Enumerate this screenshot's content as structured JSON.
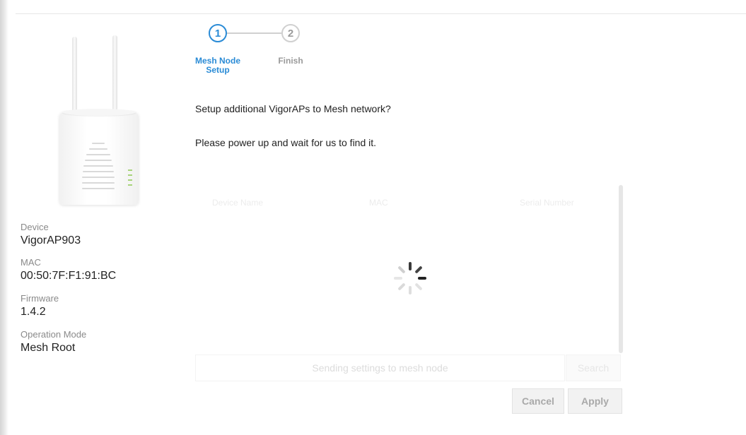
{
  "stepper": {
    "steps": [
      {
        "number": "1",
        "label": "Mesh Node\nSetup",
        "state": "active"
      },
      {
        "number": "2",
        "label": "Finish",
        "state": "inactive"
      }
    ],
    "active_color": "#2a8bd6"
  },
  "device_info": {
    "device_label": "Device",
    "device_value": "VigorAP903",
    "mac_label": "MAC",
    "mac_value": "00:50:7F:F1:91:BC",
    "firmware_label": "Firmware",
    "firmware_value": "1.4.2",
    "mode_label": "Operation Mode",
    "mode_value": "Mesh Root"
  },
  "main": {
    "question": "Setup additional VigorAPs to Mesh network?",
    "instruction": "Please power up and wait for us to find it."
  },
  "list": {
    "columns": [
      "Device Name",
      "MAC",
      "Serial Number"
    ]
  },
  "status": {
    "text": "Sending settings to mesh node"
  },
  "buttons": {
    "search": "Search",
    "cancel": "Cancel",
    "apply": "Apply"
  },
  "icons": {
    "spinner": "loading-spinner-icon",
    "device": "access-point-device-icon"
  }
}
